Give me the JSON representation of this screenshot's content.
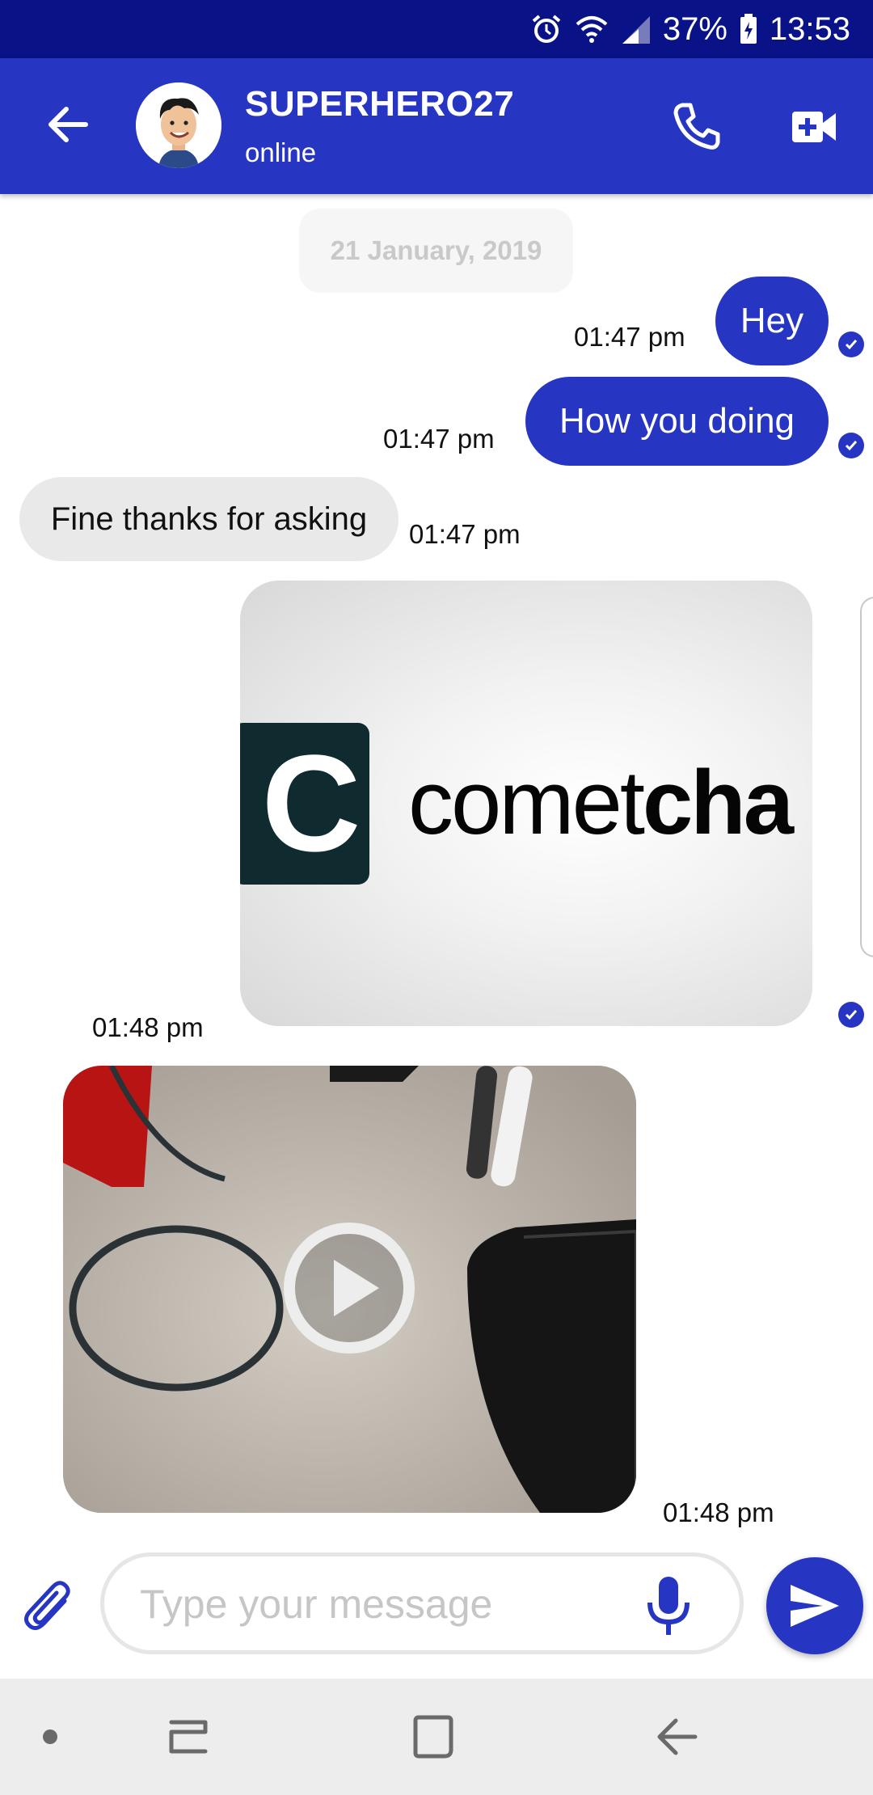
{
  "status_bar": {
    "battery": "37%",
    "time": "13:53",
    "icons": [
      "alarm-icon",
      "wifi-icon",
      "signal-icon",
      "battery-charging-icon"
    ]
  },
  "header": {
    "contact_name": "SUPERHERO27",
    "contact_status": "online",
    "icons": [
      "back-arrow-icon",
      "phone-icon",
      "video-call-icon"
    ]
  },
  "conversation": {
    "date_label": "21 January, 2019",
    "messages": [
      {
        "direction": "outgoing",
        "type": "text",
        "text": "Hey",
        "time": "01:47 pm",
        "read": true
      },
      {
        "direction": "outgoing",
        "type": "text",
        "text": "How you doing",
        "time": "01:47 pm",
        "read": true
      },
      {
        "direction": "incoming",
        "type": "text",
        "text": "Fine thanks for asking",
        "time": "01:47 pm"
      },
      {
        "direction": "outgoing",
        "type": "image",
        "image_text": {
          "icon_letter": "C",
          "word_light": "comet",
          "word_bold": "cha"
        },
        "time": "01:48 pm",
        "read": true
      },
      {
        "direction": "incoming",
        "type": "video",
        "time": "01:48 pm"
      }
    ]
  },
  "composer": {
    "placeholder": "Type your message",
    "icons": [
      "attach-icon",
      "microphone-icon",
      "send-icon"
    ]
  },
  "navigation_bar": {
    "icons": [
      "nav-dot-icon",
      "recent-apps-icon",
      "home-icon",
      "back-icon"
    ]
  },
  "colors": {
    "status_bar": "#0a1287",
    "primary": "#2636c2",
    "incoming_bubble": "#e9e9e9",
    "date_chip": "#f6f6f6",
    "nav_bar": "#ededed"
  }
}
